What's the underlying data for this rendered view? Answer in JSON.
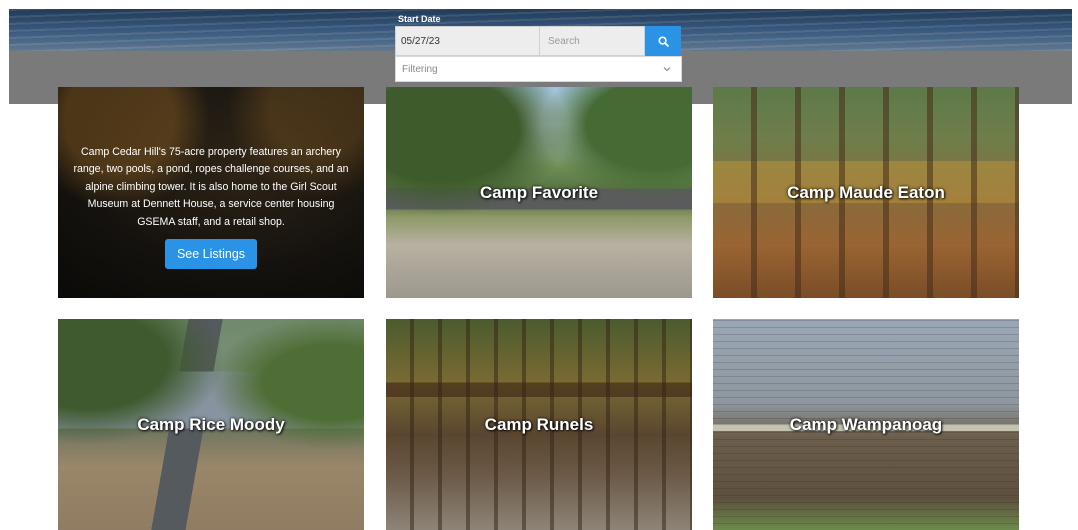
{
  "search": {
    "start_date_label": "Start Date",
    "start_date_value": "05/27/23",
    "search_placeholder": "Search",
    "filter_placeholder": "Filtering"
  },
  "intro": {
    "description": "Camp Cedar Hill's 75-acre property features an archery range, two pools, a pond, ropes challenge courses, and an alpine climbing tower. It is also home to the Girl Scout Museum at Dennett House, a service center housing GSEMA staff, and a retail shop.",
    "button_label": "See Listings"
  },
  "camps": [
    {
      "name": "Camp Favorite"
    },
    {
      "name": "Camp Maude Eaton"
    },
    {
      "name": "Camp Rice Moody"
    },
    {
      "name": "Camp Runels"
    },
    {
      "name": "Camp Wampanoag"
    }
  ],
  "icons": {
    "search": "search-icon",
    "dropdown": "chevron-down-icon"
  },
  "colors": {
    "accent": "#2a93e6"
  }
}
